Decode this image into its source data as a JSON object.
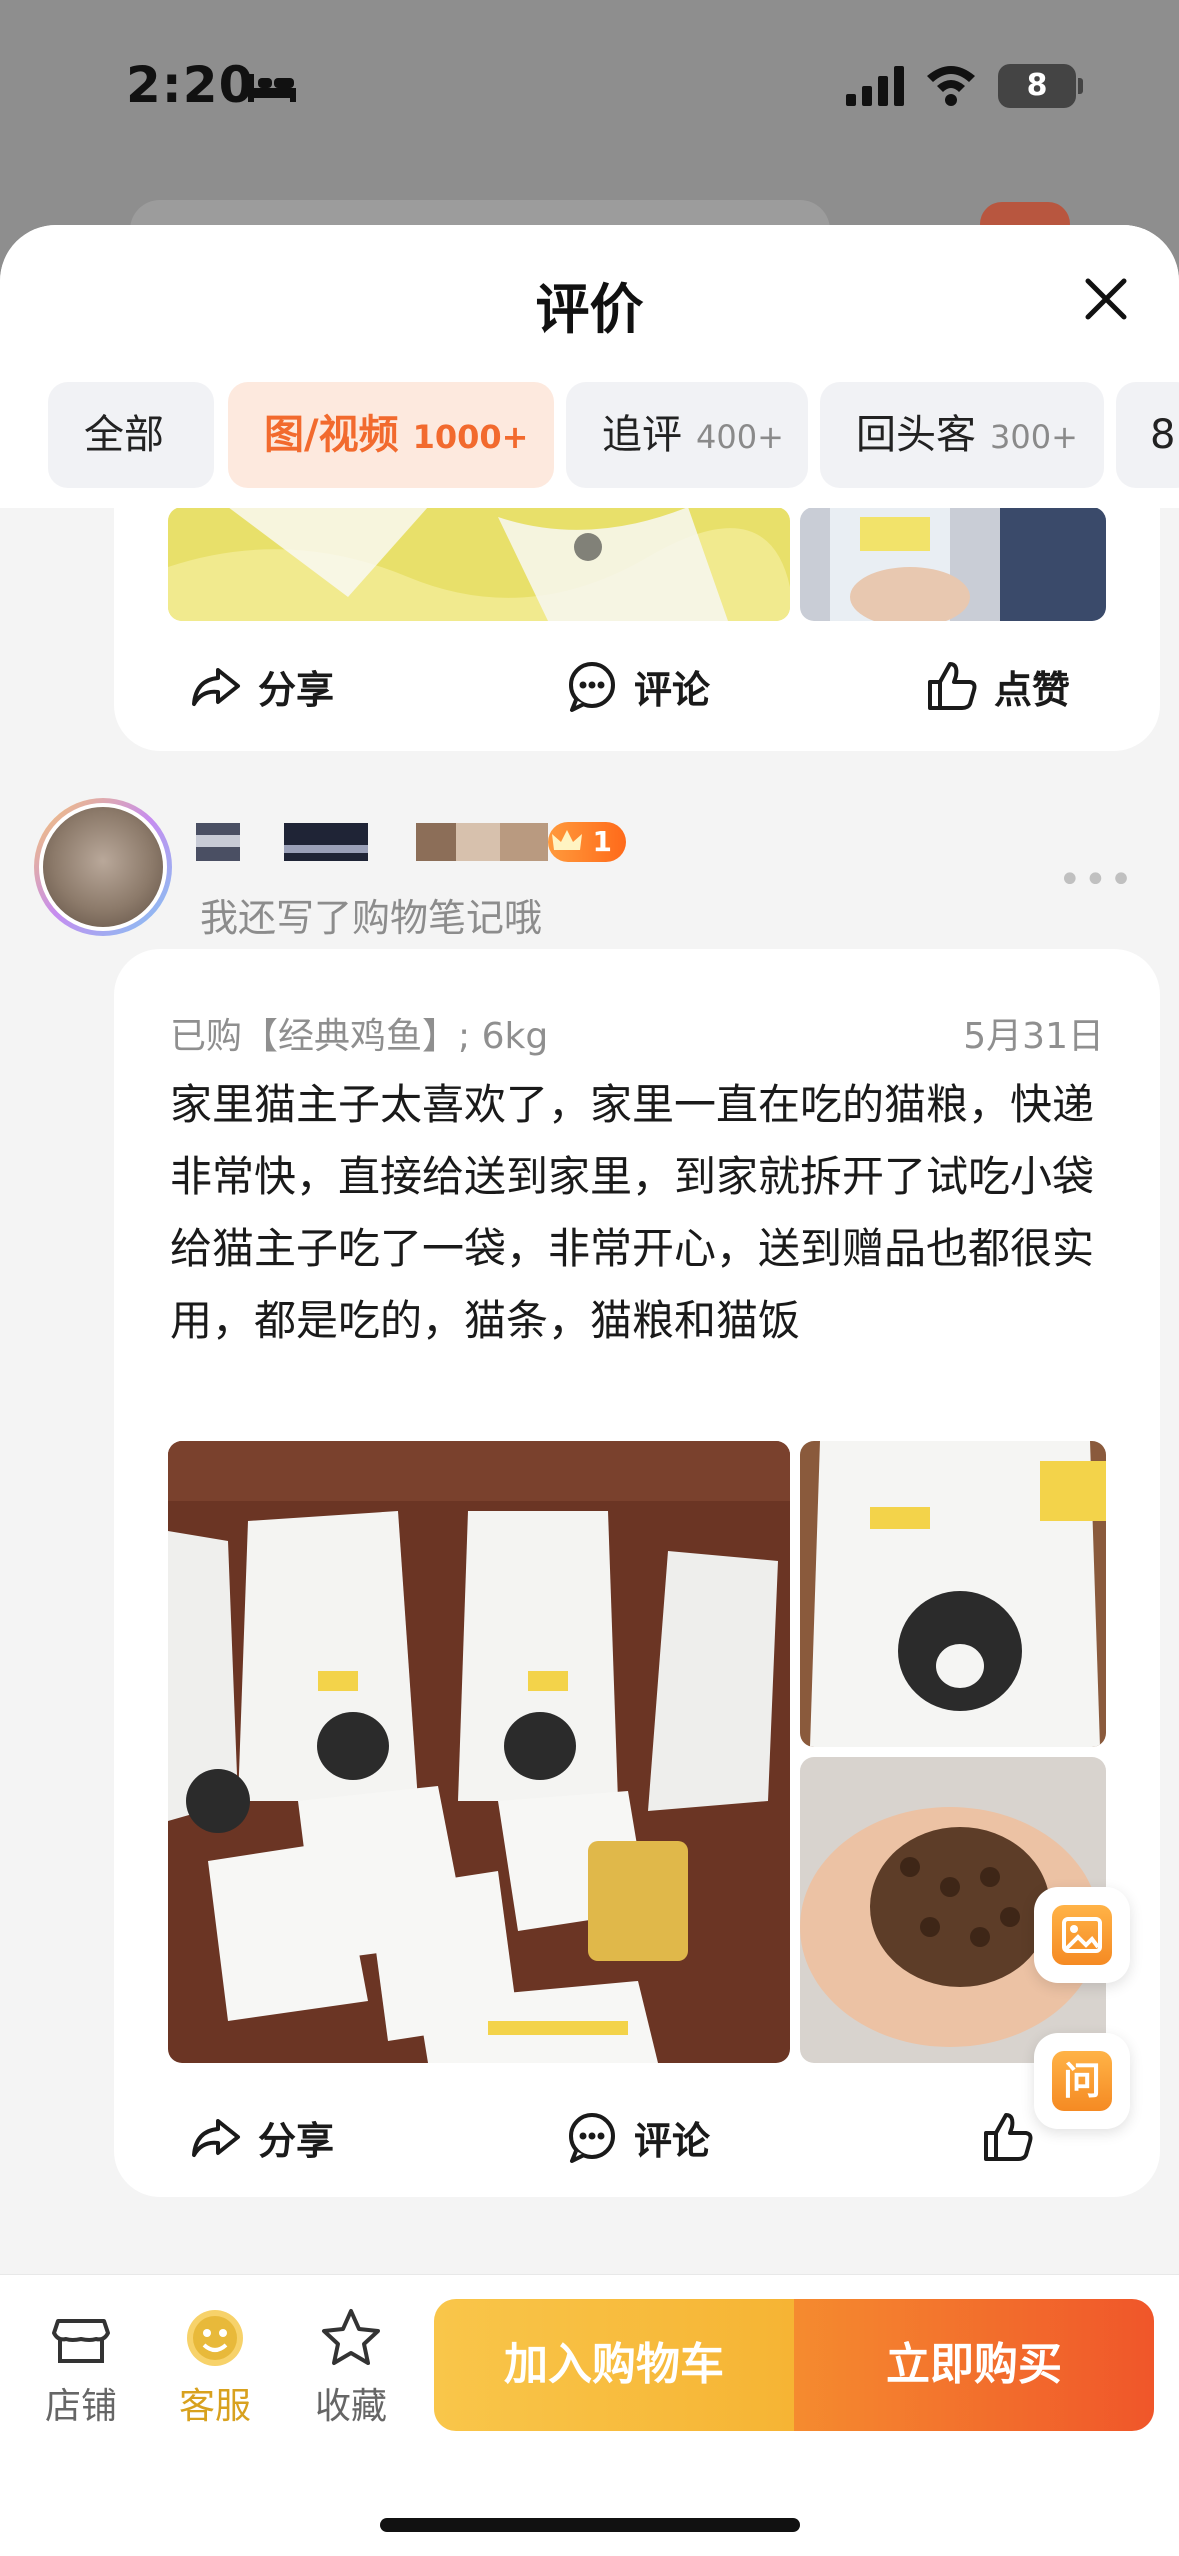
{
  "status_bar": {
    "time": "2:20",
    "battery": "8"
  },
  "sheet": {
    "title": "评价"
  },
  "filter_tabs": [
    {
      "label": "全部",
      "count": ""
    },
    {
      "label": "图/视频",
      "count": "1000+"
    },
    {
      "label": "追评",
      "count": "400+"
    },
    {
      "label": "回头客",
      "count": "300+"
    },
    {
      "label": "8",
      "count": ""
    }
  ],
  "actions": {
    "share": "分享",
    "comment": "评论",
    "like": "点赞"
  },
  "review": {
    "level": "1",
    "subtitle": "我还写了购物笔记哦",
    "purchased": "已购【经典鸡鱼】; 6kg",
    "date": "5月31日",
    "text": "家里猫主子太喜欢了，家里一直在吃的猫粮，快递非常快，直接给送到家里，到家就拆开了试吃小袋给猫主子吃了一袋，非常开心，送到赠品也都很实用，都是吃的，猫条，猫粮和猫饭"
  },
  "floating": {
    "ask": "问"
  },
  "bottom_bar": {
    "shop": "店铺",
    "service": "客服",
    "favorite": "收藏",
    "add_to_cart": "加入购物车",
    "buy_now": "立即购买"
  },
  "colors": {
    "accent": "#f26a2e",
    "cart": "#f6b434",
    "buy": "#f0562a"
  }
}
